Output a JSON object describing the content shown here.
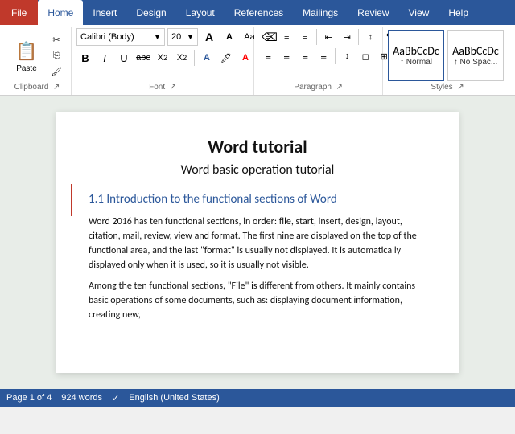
{
  "tabs": {
    "file": "File",
    "home": "Home",
    "insert": "Insert",
    "design": "Design",
    "layout": "Layout",
    "references": "References",
    "mailings": "Mailings",
    "review": "Review",
    "view": "View",
    "help": "Help"
  },
  "clipboard": {
    "paste": "Paste",
    "cut": "✂",
    "copy": "⎘",
    "format_painter": "🖌"
  },
  "font": {
    "name": "Calibri (Body)",
    "size": "20",
    "grow": "A",
    "shrink": "A",
    "change_case": "Aa",
    "clear": "⌫",
    "bold": "B",
    "italic": "I",
    "underline": "U",
    "strikethrough": "abc",
    "subscript": "X₂",
    "superscript": "X²",
    "font_color": "A",
    "highlight": "🖊",
    "text_effects": "A"
  },
  "paragraph": {
    "bullets": "≡",
    "numbering": "≡",
    "multilevel": "≡",
    "decrease_indent": "⇤",
    "increase_indent": "⇥",
    "sort": "↕",
    "show_marks": "¶",
    "align_left": "≡",
    "center": "≡",
    "align_right": "≡",
    "justify": "≡",
    "line_spacing": "↕",
    "shading": "◻",
    "borders": "⊞"
  },
  "styles": {
    "normal": {
      "label": "↑ Normal",
      "preview_text": "AaBbCcDc"
    },
    "no_spacing": {
      "label": "↑ No Spac...",
      "preview_text": "AaBbCcDc"
    }
  },
  "document": {
    "title": "Word tutorial",
    "subtitle": "Word basic operation tutorial",
    "section_heading": "1.1 Introduction to the functional sections of Word",
    "para1": "Word 2016 has ten functional sections, in order: file, start, insert, design, layout, citation, mail, review, view and format. The first nine are displayed on the top of the functional area, and the last \"format\" is usually not displayed. It is automatically displayed only when it is used, so it is usually not visible.",
    "para2": "Among the ten functional sections, \"File\" is different from others. It mainly contains basic operations of some documents, such as: displaying document information, creating new,"
  },
  "status": {
    "page": "Page 1 of 4",
    "words": "924 words",
    "language": "English (United States)"
  }
}
